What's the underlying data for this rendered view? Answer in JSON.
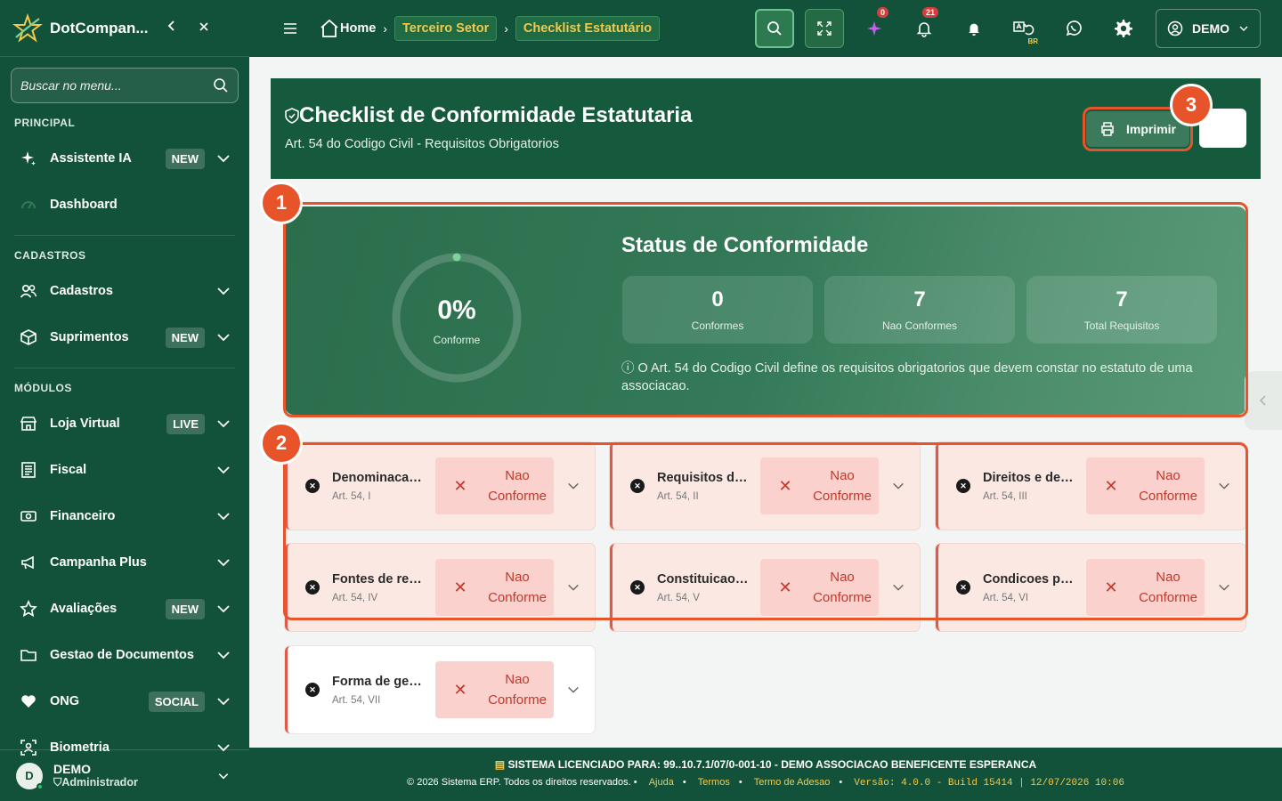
{
  "app": {
    "name": "DotCompan...",
    "collapse_icon": "chevron-left-icon",
    "close_icon": "close-icon"
  },
  "sidebar": {
    "search_placeholder": "Buscar no menu...",
    "sections": {
      "principal": "PRINCIPAL",
      "cadastros": "CADASTROS",
      "modulos": "MÓDULOS"
    },
    "items": [
      {
        "label": "Assistente IA",
        "badge": "NEW"
      },
      {
        "label": "Dashboard"
      },
      {
        "label": "Cadastros"
      },
      {
        "label": "Suprimentos",
        "badge": "NEW"
      },
      {
        "label": "Loja Virtual",
        "badge": "LIVE"
      },
      {
        "label": "Fiscal"
      },
      {
        "label": "Financeiro"
      },
      {
        "label": "Campanha Plus"
      },
      {
        "label": "Avaliações",
        "badge": "NEW"
      },
      {
        "label": "Gestao de Documentos"
      },
      {
        "label": "ONG",
        "badge": "SOCIAL"
      },
      {
        "label": "Biometria"
      }
    ],
    "user": {
      "initial": "D",
      "name": "DEMO",
      "role": "Administrador"
    }
  },
  "topbar": {
    "breadcrumb": {
      "home": "Home",
      "section": "Terceiro Setor",
      "current": "Checklist Estatutário"
    },
    "sparkle_count": "0",
    "notification_count": "21",
    "lang_tag": "BR",
    "user_label": "DEMO"
  },
  "page": {
    "title": "Checklist de Conformidade Estatutaria",
    "subtitle": "Art. 54 do Codigo Civil - Requisitos Obrigatorios",
    "print_label": "Imprimir"
  },
  "status": {
    "title": "Status de Conformidade",
    "percent": "0%",
    "percent_value": 0,
    "percent_label": "Conforme",
    "stats": [
      {
        "value": "0",
        "label": "Conformes"
      },
      {
        "value": "7",
        "label": "Nao Conformes"
      },
      {
        "value": "7",
        "label": "Total Requisitos"
      }
    ],
    "note": "O Art. 54 do Codigo Civil define os requisitos obrigatorios que devem constar no estatuto de uma associacao."
  },
  "requirements": [
    {
      "title": "Denominacao, fins e sede",
      "article": "Art. 54, I",
      "status": "Nao Conforme"
    },
    {
      "title": "Requisitos de admissao",
      "article": "Art. 54, II",
      "status": "Nao Conforme"
    },
    {
      "title": "Direitos e deveres",
      "article": "Art. 54, III",
      "status": "Nao Conforme"
    },
    {
      "title": "Fontes de recursos",
      "article": "Art. 54, IV",
      "status": "Nao Conforme"
    },
    {
      "title": "Constituicao e funcionamento",
      "article": "Art. 54, V",
      "status": "Nao Conforme"
    },
    {
      "title": "Condicoes para alteracao",
      "article": "Art. 54, VI",
      "status": "Nao Conforme"
    },
    {
      "title": "Forma de gestao",
      "article": "Art. 54, VII",
      "status": "Nao Conforme"
    }
  ],
  "annotations": [
    "1",
    "2",
    "3"
  ],
  "footer": {
    "license_prefix": "SISTEMA LICENCIADO PARA:",
    "license_value": "99..10.7.1/07/0-001-10 - DEMO ASSOCIACAO BENEFICENTE ESPERANCA",
    "copyright": "© 2026 Sistema ERP. Todos os direitos reservados.",
    "links": [
      "Ajuda",
      "Termos",
      "Termo de Adesao"
    ],
    "version": "Versão: 4.0.0 - Build 15414 | 12/07/2026 10:06"
  }
}
